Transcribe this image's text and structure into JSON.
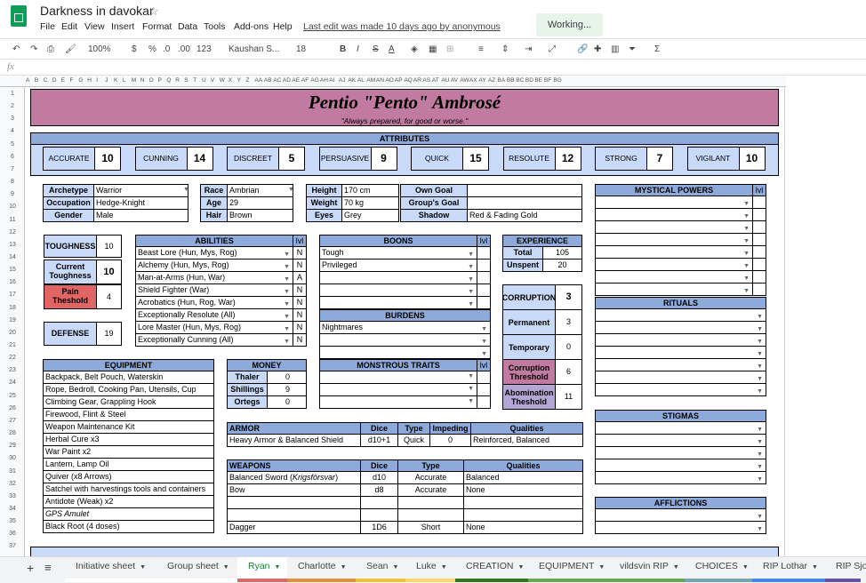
{
  "app": {
    "title": "Darkness in davokar",
    "working": "Working...",
    "last_edit": "Last edit was made 10 days ago by anonymous"
  },
  "menu": [
    "File",
    "Edit",
    "View",
    "Insert",
    "Format",
    "Data",
    "Tools",
    "Add-ons",
    "Help"
  ],
  "toolbar": {
    "zoom": "100%",
    "currency": "$",
    "percent": "%",
    "dec_less": ".0",
    "dec_more": ".00",
    "format": "123",
    "font": "Kaushan S...",
    "size": "18",
    "bold": "B",
    "italic": "I",
    "strike": "S",
    "textcolor": "A"
  },
  "formula": {
    "fx": "fx"
  },
  "columns": [
    "A",
    "B",
    "C",
    "D",
    "E",
    "F",
    "G",
    "H",
    "I",
    "J",
    "K",
    "L",
    "M",
    "N",
    "O",
    "P",
    "Q",
    "R",
    "S",
    "T",
    "U",
    "V",
    "W",
    "X",
    "Y",
    "Z",
    "AA",
    "AB",
    "AC",
    "AD",
    "AE",
    "AF",
    "AG",
    "AH",
    "AI",
    "AJ",
    "AK",
    "AL",
    "AM",
    "AN",
    "AO",
    "AP",
    "AQ",
    "AR",
    "AS",
    "AT",
    "AU",
    "AV",
    "AW",
    "AX",
    "AY",
    "AZ",
    "BA",
    "BB",
    "BC",
    "BD",
    "BE",
    "BF",
    "BG"
  ],
  "rows": [
    "1",
    "2",
    "3",
    "4",
    "5",
    "6",
    "7",
    "8",
    "9",
    "10",
    "11",
    "12",
    "13",
    "14",
    "15",
    "16",
    "17",
    "18",
    "19",
    "20",
    "21",
    "22",
    "23",
    "24",
    "25",
    "26",
    "27",
    "28",
    "29",
    "30",
    "31",
    "32",
    "33",
    "34",
    "35",
    "36",
    "37"
  ],
  "sheet": {
    "name": "Pentio \"Pento\" Ambrosé",
    "motto": "\"Always prepared, for good or worse.\"",
    "attributes_title": "ATTRIBUTES",
    "attributes": [
      {
        "label": "ACCURATE",
        "value": "10"
      },
      {
        "label": "CUNNING",
        "value": "14"
      },
      {
        "label": "DISCREET",
        "value": "5"
      },
      {
        "label": "PERSUASIVE",
        "value": "9"
      },
      {
        "label": "QUICK",
        "value": "15"
      },
      {
        "label": "RESOLUTE",
        "value": "12"
      },
      {
        "label": "STRONG",
        "value": "7"
      },
      {
        "label": "VIGILANT",
        "value": "10"
      }
    ],
    "info1": [
      {
        "label": "Archetype",
        "value": "Warrior"
      },
      {
        "label": "Occupation",
        "value": "Hedge-Knight"
      },
      {
        "label": "Gender",
        "value": "Male"
      }
    ],
    "info2": [
      {
        "label": "Race",
        "value": "Ambrian"
      },
      {
        "label": "Age",
        "value": "29"
      },
      {
        "label": "Hair",
        "value": "Brown"
      }
    ],
    "info3": [
      {
        "label": "Height",
        "value": "170 cm"
      },
      {
        "label": "Weight",
        "value": "70 kg"
      },
      {
        "label": "Eyes",
        "value": "Grey"
      }
    ],
    "info4": [
      {
        "label": "Own Goal",
        "value": ""
      },
      {
        "label": "Group's Goal",
        "value": ""
      },
      {
        "label": "Shadow",
        "value": "Red & Fading Gold"
      }
    ],
    "toughness": {
      "label": "TOUGHNESS",
      "value": "10",
      "current_label": "Current Toughness",
      "current": "10",
      "pain_label": "Pain Theshold",
      "pain": "4"
    },
    "defense": {
      "label": "DEFENSE",
      "value": "19"
    },
    "abilities": {
      "title": "ABILITIES",
      "lvl": "lvl",
      "items": [
        {
          "name": "Beast Lore (Hun, Mys, Rog)",
          "lvl": "N"
        },
        {
          "name": "Alchemy (Hun, Mys, Rog)",
          "lvl": "N"
        },
        {
          "name": "Man-at-Arms (Hun, War)",
          "lvl": "A"
        },
        {
          "name": "Shield Fighter (War)",
          "lvl": "N"
        },
        {
          "name": "Acrobatics (Hun, Rog, War)",
          "lvl": "N"
        },
        {
          "name": "Exceptionally Resolute (All)",
          "lvl": "N"
        },
        {
          "name": "Lore Master (Hun, Mys, Rog)",
          "lvl": "N"
        },
        {
          "name": "Exceptionally Cunning (All)",
          "lvl": "N"
        }
      ]
    },
    "boons": {
      "title": "BOONS",
      "lvl": "lvl",
      "items": [
        "Tough",
        "Privileged",
        "",
        "",
        "",
        ""
      ]
    },
    "burdens": {
      "title": "BURDENS",
      "items": [
        "Nightmares",
        "",
        ""
      ]
    },
    "experience": {
      "title": "EXPERIENCE",
      "total_label": "Total",
      "total": "105",
      "unspent_label": "Unspent",
      "unspent": "20"
    },
    "corruption": {
      "label": "CORRUPTION",
      "value": "3",
      "permanent_label": "Permanent",
      "permanent": "3",
      "temporary_label": "Temporary",
      "temporary": "0",
      "threshold_label": "Corruption Threshold",
      "threshold": "6",
      "abomination_label": "Abomination Theshold",
      "abomination": "11"
    },
    "mystical": {
      "title": "MYSTICAL POWERS",
      "lvl": "lvl"
    },
    "rituals": {
      "title": "RITUALS"
    },
    "stigmas": {
      "title": "STIGMAS"
    },
    "afflictions": {
      "title": "AFFLICTIONS"
    },
    "equipment": {
      "title": "EQUIPMENT",
      "items": [
        "Backpack, Belt Pouch, Waterskin",
        "Rope, Bedroll, Cooking Pan, Utensils, Cup",
        "Climbing Gear, Grappling Hook",
        "Firewood, Flint & Steel",
        "Weapon Maintenance Kit",
        "Herbal Cure x3",
        "War Paint x2",
        "Lantern, Lamp Oil",
        "Quiver (x8 Arrows)",
        "Satchel with harvestings tools and containers",
        "Antidote (Weak) x2",
        "GPS Amulet",
        "Black Root (4 doses)"
      ]
    },
    "money": {
      "title": "MONEY",
      "items": [
        {
          "label": "Thaler",
          "value": "0"
        },
        {
          "label": "Shillings",
          "value": "9"
        },
        {
          "label": "Ortegs",
          "value": "0"
        }
      ]
    },
    "monstrous": {
      "title": "MONSTROUS TRAITS",
      "lvl": "lvl"
    },
    "armor": {
      "headers": [
        "ARMOR",
        "Dice",
        "Type",
        "Impeding",
        "Qualities"
      ],
      "row": [
        "Heavy Armor & Balanced Shield",
        "d10+1",
        "Quick",
        "0",
        "Reinforced, Balanced"
      ]
    },
    "weapons": {
      "headers": [
        "WEAPONS",
        "Dice",
        "Type",
        "Qualities"
      ],
      "rows": [
        [
          "Balanced Sword (",
          "Krigsförsvar",
          ")",
          "d10",
          "Accurate",
          "Balanced"
        ],
        [
          "Bow",
          "",
          "",
          "d8",
          "Accurate",
          "None"
        ],
        [
          "",
          "",
          "",
          "",
          "",
          ""
        ],
        [
          "",
          "",
          "",
          "",
          "",
          ""
        ],
        [
          "Dagger",
          "",
          "",
          "1D6",
          "Short",
          "None"
        ]
      ]
    }
  },
  "tabs": [
    "Initiative sheet",
    "Group sheet",
    "Ryan",
    "Charlotte",
    "Sean",
    "Luke",
    "CREATION",
    "EQUIPMENT",
    "vildsvin RIP",
    "CHOICES",
    "RIP Lothar",
    "RIP Sjof"
  ],
  "tab_colors": [
    "#ffffff",
    "#ffffff",
    "#e06666",
    "#e69138",
    "#f1c232",
    "#ffd966",
    "#38761d",
    "#6aa84f",
    "#6aa84f",
    "#76a5af",
    "#4285f4",
    "#674ea7"
  ],
  "icons": {
    "logo": "sheets-logo-icon",
    "star": "star-icon"
  }
}
